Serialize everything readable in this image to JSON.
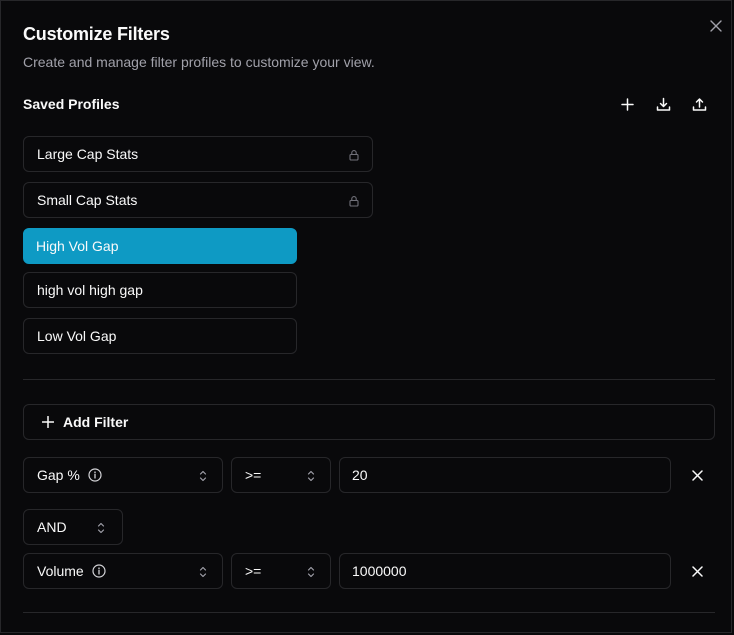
{
  "dialog": {
    "title": "Customize Filters",
    "subtitle": "Create and manage filter profiles to customize your view."
  },
  "profiles_section": {
    "title": "Saved Profiles",
    "items": [
      {
        "label": "Large Cap Stats",
        "locked": true,
        "active": false
      },
      {
        "label": "Small Cap Stats",
        "locked": true,
        "active": false
      },
      {
        "label": "High Vol Gap",
        "locked": false,
        "active": true
      },
      {
        "label": "high vol high gap",
        "locked": false,
        "active": false
      },
      {
        "label": "Low Vol Gap",
        "locked": false,
        "active": false
      }
    ]
  },
  "filters": {
    "add_label": "Add Filter",
    "rows": [
      {
        "field": "Gap %",
        "operator": ">=",
        "value": "20"
      },
      {
        "field": "Volume",
        "operator": ">=",
        "value": "1000000"
      }
    ],
    "connector": "AND"
  },
  "icons": {
    "close": "close-icon",
    "add": "plus-icon",
    "import": "download-icon",
    "export": "upload-icon",
    "lock": "lock-icon",
    "info": "info-icon",
    "chevrons": "chevrons-up-down-icon",
    "remove": "x-icon"
  },
  "colors": {
    "background": "#09090b",
    "border": "#27272a",
    "accent": "#0e9ac4",
    "muted_text": "#a1a1aa"
  }
}
